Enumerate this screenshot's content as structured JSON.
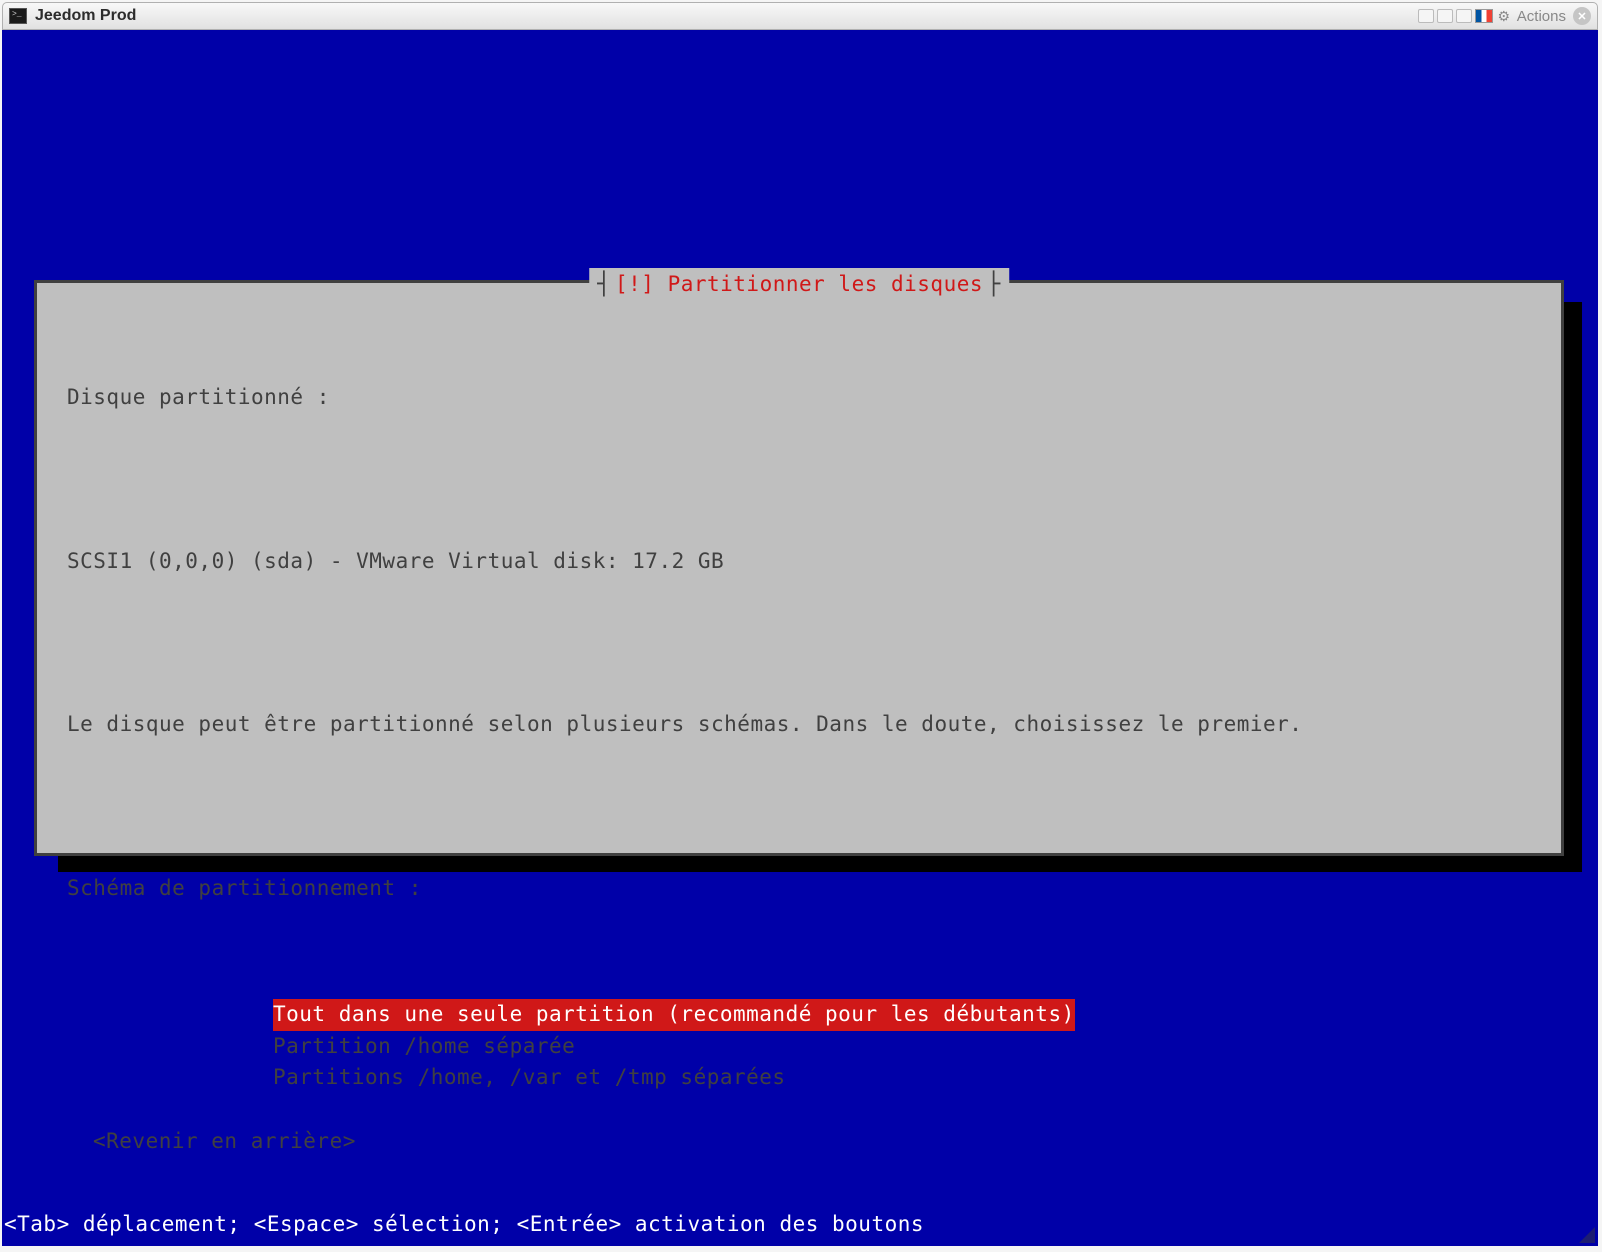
{
  "window": {
    "title": "Jeedom Prod",
    "actions_label": "Actions"
  },
  "dialog": {
    "title": "[!] Partitionner les disques",
    "heading": "Disque partitionné :",
    "disk_info": "SCSI1 (0,0,0) (sda) - VMware Virtual disk: 17.2 GB",
    "description": "Le disque peut être partitionné selon plusieurs schémas. Dans le doute, choisissez le premier.",
    "scheme_label": "Schéma de partitionnement :",
    "options": [
      "Tout dans une seule partition (recommandé pour les débutants)",
      "Partition /home séparée",
      "Partitions /home, /var et /tmp séparées"
    ],
    "selected_index": 0,
    "back_button": "<Revenir en arrière>"
  },
  "footer": {
    "help_text": "<Tab> déplacement; <Espace> sélection; <Entrée> activation des boutons"
  }
}
